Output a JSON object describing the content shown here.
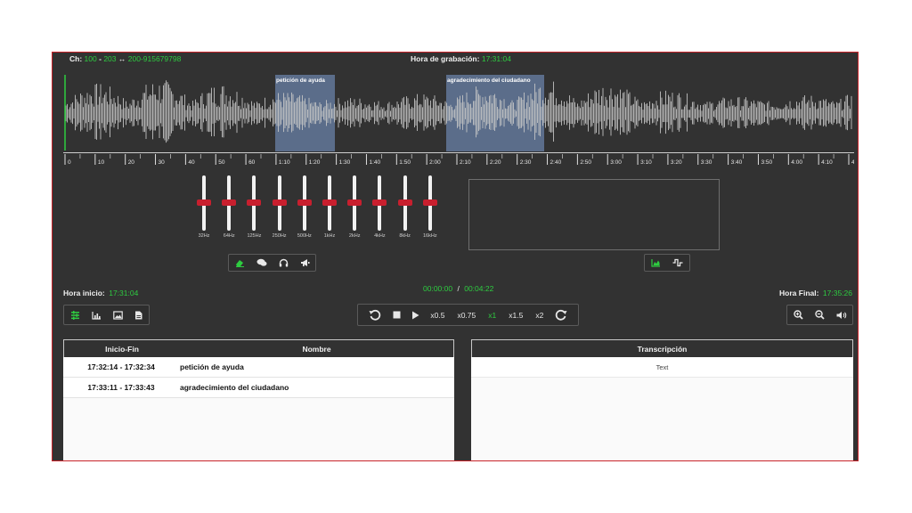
{
  "header": {
    "ch_label": "Ch:",
    "ch_from": "100",
    "ch_dash": "-",
    "ch_ext": "203",
    "ch_arrow": "↔",
    "ch_to": "200-915679798",
    "recording_label": "Hora de grabación:",
    "recording_time": "17:31:04"
  },
  "regions": [
    {
      "label": "petición de ayuda"
    },
    {
      "label": "agradecimiento del ciudadano"
    }
  ],
  "ruler": {
    "ticks": [
      "0",
      "10",
      "20",
      "30",
      "40",
      "50",
      "60",
      "1:10",
      "1:20",
      "1:30",
      "1:40",
      "1:50",
      "2:00",
      "2:10",
      "2:20",
      "2:30",
      "2:40",
      "2:50",
      "3:00",
      "3:10",
      "3:20",
      "3:30",
      "3:40",
      "3:50",
      "4:00",
      "4:10",
      "4"
    ]
  },
  "equalizer": {
    "bands": [
      "32Hz",
      "64Hz",
      "125Hz",
      "250Hz",
      "500Hz",
      "1kHz",
      "2kHz",
      "4kHz",
      "8kHz",
      "16kHz"
    ]
  },
  "equalizer_toolbar": {
    "icons": [
      "eraser-icon",
      "comments-icon",
      "headphones-icon",
      "bullhorn-icon"
    ]
  },
  "spectrum_toolbar": {
    "icons": [
      "area-chart-icon",
      "signal-wave-icon"
    ]
  },
  "times": {
    "start_label": "Hora inicio:",
    "start_value": "17:31:04",
    "current": "00:00:00",
    "separator": "/",
    "total": "00:04:22",
    "end_label": "Hora Final:",
    "end_value": "17:35:26"
  },
  "left_toolbar": {
    "icons": [
      "list-icon",
      "bar-chart-icon",
      "image-icon",
      "file-icon"
    ]
  },
  "player": {
    "speeds": [
      "x0.5",
      "x0.75",
      "x1",
      "x1.5",
      "x2"
    ],
    "active_speed": "x1",
    "active_color": "#2ecc40"
  },
  "right_toolbar": {
    "icons": [
      "zoom-in-icon",
      "zoom-out-icon",
      "volume-icon"
    ]
  },
  "segments_table": {
    "headers": [
      "Inicio-Fin",
      "Nombre"
    ],
    "rows": [
      {
        "range": "17:32:14 - 17:32:34",
        "name": "petición de ayuda"
      },
      {
        "range": "17:33:11 - 17:33:43",
        "name": "agradecimiento del ciudadano"
      }
    ]
  },
  "transcription": {
    "header": "Transcripción",
    "text": "Text"
  },
  "colors": {
    "background": "#323232",
    "accent_green": "#2ecc40",
    "region_blue": "#5b6d8a",
    "knob_red": "#c81f2e",
    "frame_red": "#c8242a"
  }
}
